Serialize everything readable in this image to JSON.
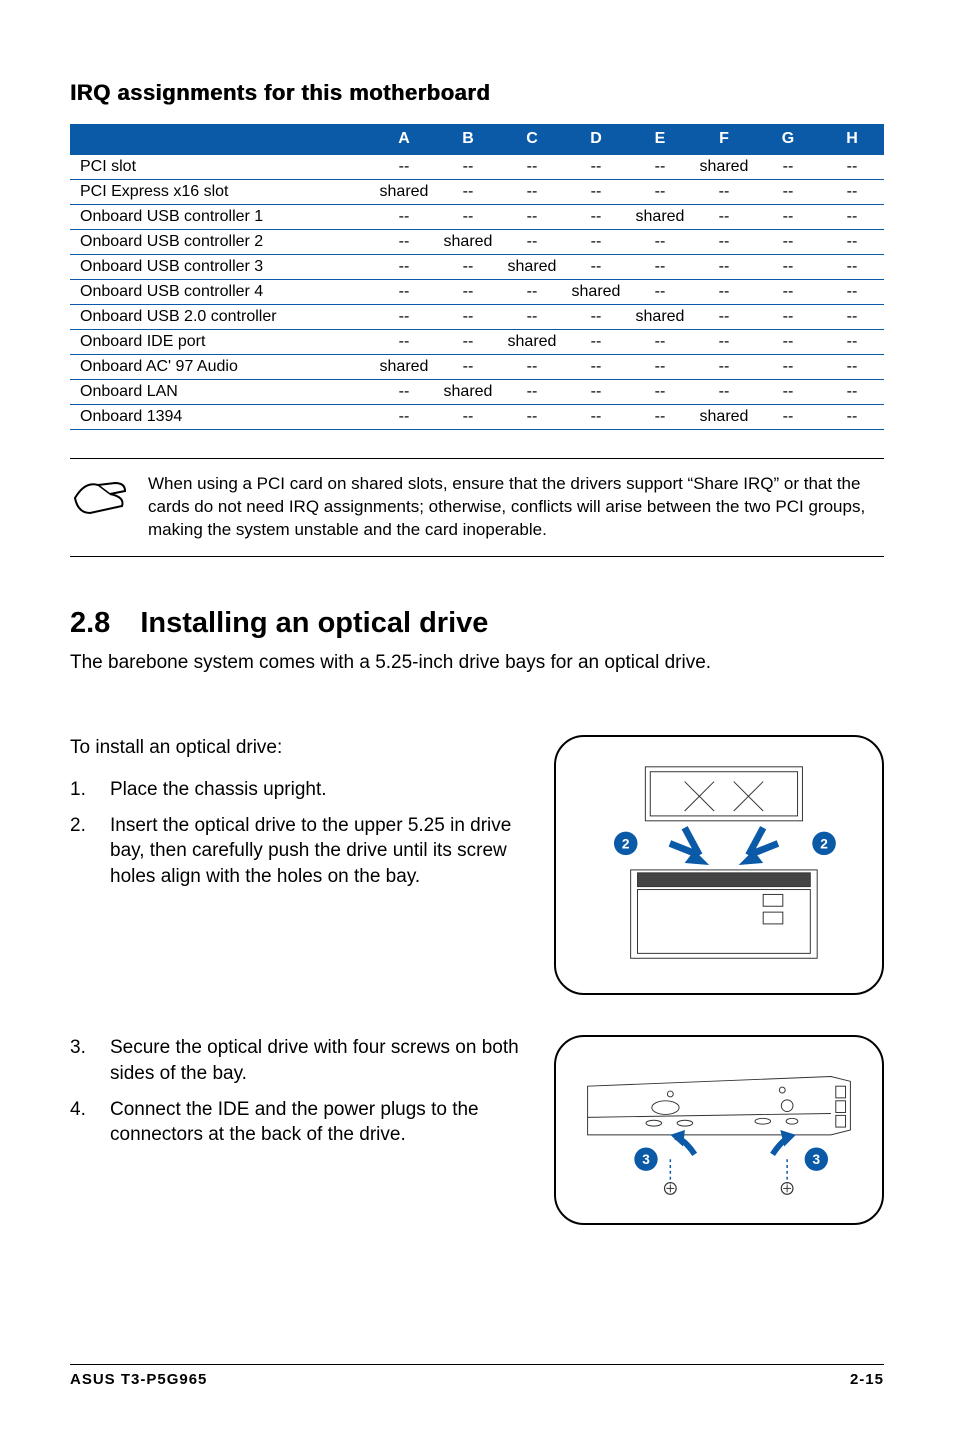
{
  "irq": {
    "heading": "IRQ assignments for this motherboard",
    "columns": [
      "A",
      "B",
      "C",
      "D",
      "E",
      "F",
      "G",
      "H"
    ],
    "rows": [
      {
        "label": "PCI slot",
        "cells": [
          "--",
          "--",
          "--",
          "--",
          "--",
          "shared",
          "--",
          "--"
        ]
      },
      {
        "label": "PCI Express x16 slot",
        "cells": [
          "shared",
          "--",
          "--",
          "--",
          "--",
          "--",
          "--",
          "--"
        ]
      },
      {
        "label": "Onboard USB controller 1",
        "cells": [
          "--",
          "--",
          "--",
          "--",
          "shared",
          "--",
          "--",
          "--"
        ]
      },
      {
        "label": "Onboard USB controller 2",
        "cells": [
          "--",
          "shared",
          "--",
          "--",
          "--",
          "--",
          "--",
          "--"
        ]
      },
      {
        "label": "Onboard USB controller 3",
        "cells": [
          "--",
          "--",
          "shared",
          "--",
          "--",
          "--",
          "--",
          "--"
        ]
      },
      {
        "label": "Onboard USB controller 4",
        "cells": [
          "--",
          "--",
          "--",
          "shared",
          "--",
          "--",
          "--",
          "--"
        ]
      },
      {
        "label": "Onboard USB 2.0 controller",
        "cells": [
          "--",
          "--",
          "--",
          "--",
          "shared",
          "--",
          "--",
          "--"
        ]
      },
      {
        "label": "Onboard IDE port",
        "cells": [
          "--",
          "--",
          "shared",
          "--",
          "--",
          "--",
          "--",
          "--"
        ]
      },
      {
        "label": "Onboard AC' 97 Audio",
        "cells": [
          "shared",
          "--",
          "--",
          "--",
          "--",
          "--",
          "--",
          "--"
        ]
      },
      {
        "label": "Onboard LAN",
        "cells": [
          "--",
          "shared",
          "--",
          "--",
          "--",
          "--",
          "--",
          "--"
        ]
      },
      {
        "label": "Onboard 1394",
        "cells": [
          "--",
          "--",
          "--",
          "--",
          "--",
          "shared",
          "--",
          "--"
        ]
      }
    ]
  },
  "note": "When using a PCI card on shared slots, ensure that the drivers support “Share IRQ” or that the cards do not need IRQ assignments; otherwise, conflicts will arise between the two PCI groups, making the system unstable and the card inoperable.",
  "section28": {
    "number": "2.8",
    "title": "Installing an optical drive",
    "intro": "The barebone system comes with a 5.25-inch drive bays for an optical drive.",
    "lead": "To install an optical drive:",
    "steps": [
      {
        "n": "1.",
        "text": "Place the chassis upright."
      },
      {
        "n": "2.",
        "text": "Insert the optical drive to the upper 5.25 in drive bay, then carefully push the drive until its screw holes align with the holes on the bay."
      },
      {
        "n": "3.",
        "text": "Secure the optical drive with four screws on both sides of the bay."
      },
      {
        "n": "4.",
        "text": "Connect the IDE and the power plugs to the connectors at the back of the drive."
      }
    ],
    "badge2": "2",
    "badge3": "3"
  },
  "footer": {
    "left": "ASUS T3-P5G965",
    "right": "2-15"
  }
}
